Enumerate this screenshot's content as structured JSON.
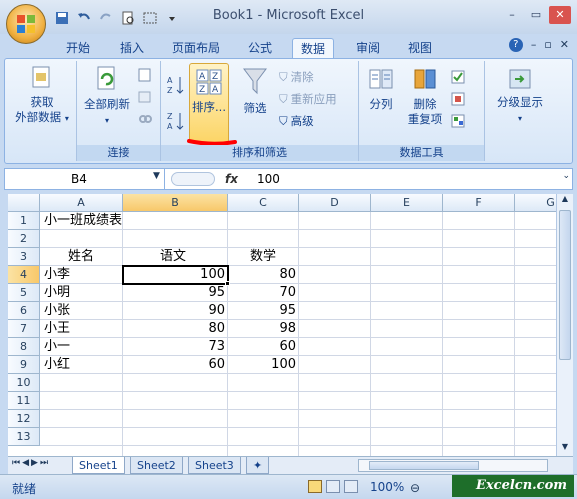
{
  "window": {
    "title": "Book1 - Microsoft Excel",
    "minimize": "–",
    "restore": "▭",
    "close": "✕"
  },
  "tabs": [
    "开始",
    "插入",
    "页面布局",
    "公式",
    "数据",
    "审阅",
    "视图"
  ],
  "active_tab": "数据",
  "ribbon": {
    "external_data": {
      "line1": "获取",
      "line2": "外部数据"
    },
    "connections": {
      "refresh_all": "全部刷新",
      "group": "连接"
    },
    "sort_filter": {
      "sort": "排序...",
      "filter": "筛选",
      "clear": "清除",
      "reapply": "重新应用",
      "advanced": "高级",
      "group": "排序和筛选"
    },
    "data_tools": {
      "text_to_columns": "分列",
      "remove_dup_1": "删除",
      "remove_dup_2": "重复项",
      "group": "数据工具"
    },
    "outline": {
      "label": "分级显示"
    }
  },
  "formula_bar": {
    "name_box": "B4",
    "fx": "fx",
    "value": "100"
  },
  "columns": [
    "A",
    "B",
    "C",
    "D",
    "E",
    "F",
    "G"
  ],
  "rows": [
    "1",
    "2",
    "3",
    "4",
    "5",
    "6",
    "7",
    "8",
    "9",
    "10",
    "11",
    "12",
    "13"
  ],
  "cells": {
    "title": "小一班成绩表",
    "header_name": "姓名",
    "header_chinese": "语文",
    "header_math": "数学",
    "records": [
      {
        "name": "小李",
        "chinese": "100",
        "math": "80"
      },
      {
        "name": "小明",
        "chinese": "95",
        "math": "70"
      },
      {
        "name": "小张",
        "chinese": "90",
        "math": "95"
      },
      {
        "name": "小王",
        "chinese": "80",
        "math": "98"
      },
      {
        "name": "小一",
        "chinese": "73",
        "math": "60"
      },
      {
        "name": "小红",
        "chinese": "60",
        "math": "100"
      }
    ]
  },
  "sheets": [
    "Sheet1",
    "Sheet2",
    "Sheet3"
  ],
  "status": {
    "ready": "就绪",
    "zoom": "100%"
  },
  "watermark": "Excelcn.com",
  "colors": {
    "accent": "#15428b",
    "selected_header": "#f8c86a",
    "annotation": "#ff0000"
  }
}
